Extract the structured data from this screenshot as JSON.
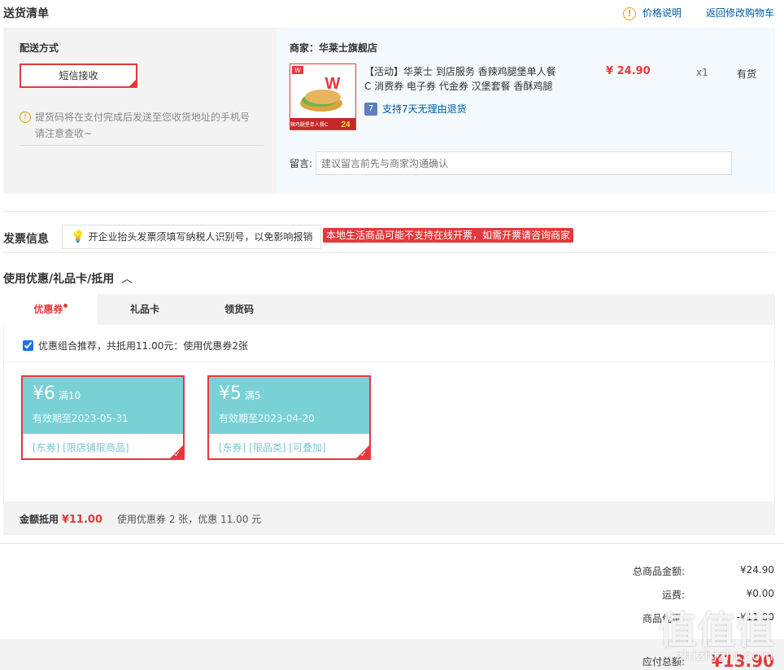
{
  "header": {
    "title": "送货清单",
    "price_info_label": "价格说明",
    "back_to_cart_label": "返回修改购物车"
  },
  "delivery": {
    "label": "配送方式",
    "method_button": "短信接收",
    "tip_line1": "提货码将在支付完成后发送至您收货地址的手机号",
    "tip_line2": "请注意查收~"
  },
  "merchant": {
    "label": "商家：华莱士旗舰店"
  },
  "product": {
    "name_line1": "【活动】华莱士 到店服务 香辣鸡腿堡单人餐",
    "name_line2": "C 消费券 电子券 代金券 汉堡套餐 香酥鸡腿",
    "price": "¥ 24.90",
    "qty": "x1",
    "stock": "有货",
    "return_policy": "支持7天无理由退货",
    "return_icon": "7",
    "image_caption": "香辣鸡腿堡单人餐C",
    "image_price": "24"
  },
  "note": {
    "label": "留言:",
    "placeholder": "建议留言前先与商家沟通确认"
  },
  "invoice": {
    "title": "发票信息",
    "tip": "开企业抬头发票须填写纳税人识别号，以免影响报销",
    "warning": "本地生活商品可能不支持在线开票，如需开票请咨询商家"
  },
  "coupons": {
    "title": "使用优惠/礼品卡/抵用",
    "tabs": [
      {
        "label": "优惠券"
      },
      {
        "label": "礼品卡"
      },
      {
        "label": "领货码"
      }
    ],
    "combo_text": "优惠组合推荐，共抵用11.00元：使用优惠券2张",
    "items": [
      {
        "amount": "¥6",
        "condition": "满10",
        "expiry": "有效期至2023-05-31",
        "tags": "[东券]  [限店铺限商品]"
      },
      {
        "amount": "¥5",
        "condition": "满5",
        "expiry": "有效期至2023-04-20",
        "tags": "[东券]  [限品类]  [可叠加]"
      }
    ],
    "deduct_label": "金额抵用",
    "deduct_value": "¥11.00",
    "deduct_desc": "使用优惠券 2 张，优惠 11.00 元"
  },
  "summary": {
    "rows": [
      {
        "label": "总商品金额:",
        "value": "¥24.90"
      },
      {
        "label": "运费:",
        "value": "¥0.00"
      },
      {
        "label": "商品优惠:",
        "value": "-¥11.00"
      }
    ],
    "total_label": "应付总额:",
    "total_value": "¥13.90"
  },
  "watermark": {
    "main": "值值值",
    "sub": "zhizhizhi.com"
  },
  "colors": {
    "accent": "#e4393c",
    "link": "#005aa0",
    "coupon_bg": "#79d1d5"
  }
}
